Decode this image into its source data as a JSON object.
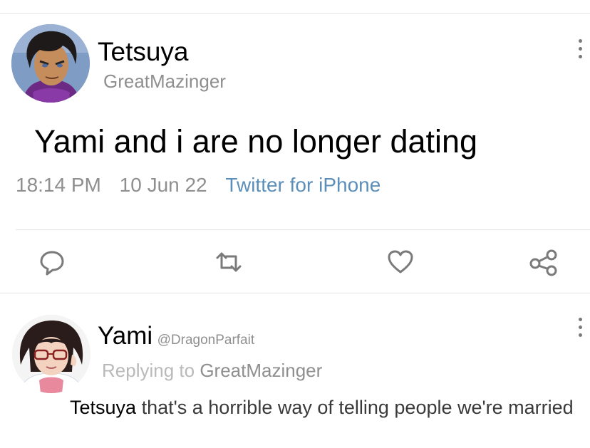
{
  "tweet": {
    "author": {
      "display_name": "Tetsuya",
      "handle": "GreatMazinger",
      "avatar_icon": "avatar-anime-man"
    },
    "text": "Yami and i are no longer dating",
    "time": "18:14 PM",
    "date": "10 Jun 22",
    "source": "Twitter for iPhone",
    "source_color": "#5b8fb9",
    "more_icon": "more-vertical-icon",
    "actions": [
      {
        "name": "reply",
        "icon": "reply-bubble-icon"
      },
      {
        "name": "retweet",
        "icon": "retweet-icon"
      },
      {
        "name": "like",
        "icon": "heart-icon"
      },
      {
        "name": "share",
        "icon": "share-icon"
      }
    ]
  },
  "reply": {
    "author": {
      "display_name": "Yami",
      "handle": "@DragonParfait",
      "avatar_icon": "avatar-anime-woman-glasses"
    },
    "replying_prefix": "Replying to",
    "replying_to": "GreatMazinger",
    "mention": "Tetsuya",
    "text": "that's a horrible way of telling people we're married",
    "more_icon": "more-vertical-icon"
  },
  "colors": {
    "icon_grey": "#7a7a7a",
    "meta_grey": "#8f8f8f",
    "divider": "#e6e6e6"
  }
}
